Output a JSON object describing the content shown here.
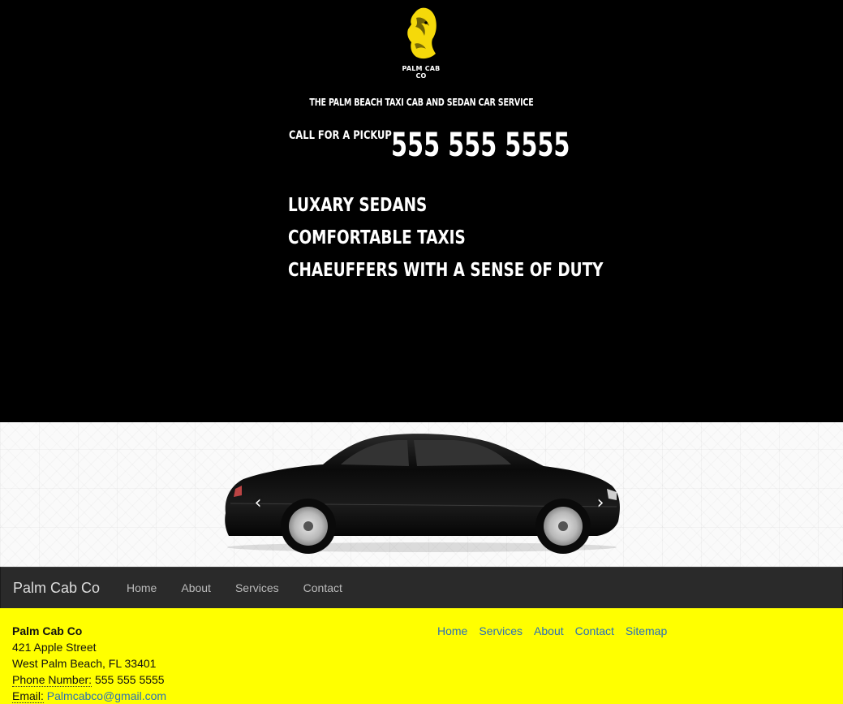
{
  "hero": {
    "logo_text": "PALM CAB CO",
    "tagline": "THE PALM BEACH TAXI CAB AND SEDAN CAR SERVICE",
    "call_label": "CALL FOR A PICKUP",
    "phone": "555 555 5555",
    "features": [
      "LUXARY SEDANS",
      "COMFORTABLE TAXIS",
      "CHAEUFFERS WITH A SENSE OF DUTY"
    ]
  },
  "carousel": {
    "prev_label": "Previous",
    "next_label": "Next",
    "prev_icon": "chevron-left-icon",
    "next_icon": "chevron-right-icon"
  },
  "navbar": {
    "brand": "Palm Cab Co",
    "items": [
      "Home",
      "About",
      "Services",
      "Contact"
    ]
  },
  "footer": {
    "name": "Palm Cab Co",
    "street": "421 Apple Street",
    "city": "West Palm Beach, FL 33401",
    "phone_label": "Phone Number:",
    "phone": "555 555 5555",
    "email_label": "Email:",
    "email": "Palmcabco@gmail.com",
    "links": [
      "Home",
      "Services",
      "About",
      "Contact",
      "Sitemap"
    ]
  },
  "colors": {
    "accent_yellow": "#ffff00",
    "logo_gold": "#f5d90a",
    "link_blue": "#2a6fb8",
    "navbar_bg": "#2a2a2a"
  }
}
